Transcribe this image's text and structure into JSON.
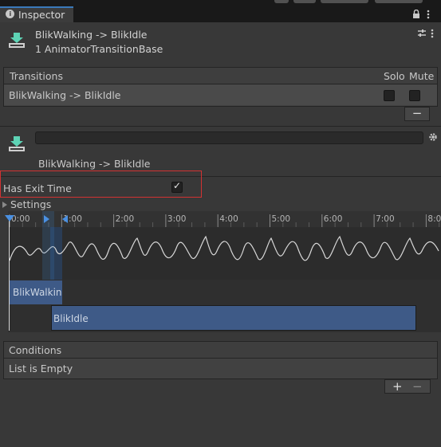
{
  "window": {
    "tab_title": "Inspector",
    "lock_icon": "lock-icon",
    "menu_icon": "kebab-menu-icon"
  },
  "header": {
    "title": "BlikWalking -> BlikIdle",
    "subtitle": "1 AnimatorTransitionBase",
    "icon": "transition-icon",
    "settings_icon": "preset-sliders-icon"
  },
  "transitions": {
    "header": "Transitions",
    "solo_label": "Solo",
    "mute_label": "Mute",
    "rows": [
      {
        "name": "BlikWalking -> BlikIdle",
        "solo": false,
        "mute": false
      }
    ],
    "remove_button": "−"
  },
  "transition_detail": {
    "name_field_value": "",
    "title": "BlikWalking -> BlikIdle",
    "has_exit_time_label": "Has Exit Time",
    "has_exit_time_checked": true,
    "check_glyph": "✓",
    "settings_label": "Settings",
    "gear_icon": "gear-icon"
  },
  "timeline": {
    "ticks": [
      "0:00",
      "1:00",
      "2:00",
      "3:00",
      "4:00",
      "5:00",
      "6:00",
      "7:00",
      "8:0"
    ],
    "source_state": "BlikWalking",
    "destination_state": "BlikIdle",
    "colors": {
      "state": "#3e5a87",
      "marker": "#4a90e2",
      "highlight": "#2a4a78"
    }
  },
  "conditions": {
    "header": "Conditions",
    "empty_text": "List is Empty",
    "add_button": "+",
    "remove_button": "−"
  },
  "colors": {
    "background": "#383838",
    "highlight_border": "#d23232",
    "accent": "#3a79bb"
  }
}
